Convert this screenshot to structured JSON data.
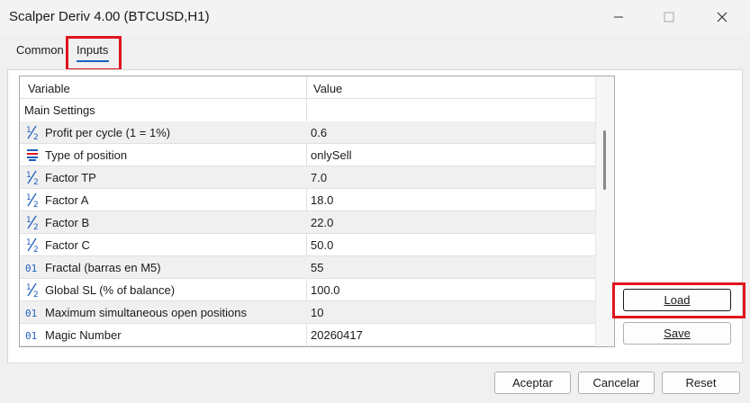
{
  "window": {
    "title": "Scalper Deriv 4.00 (BTCUSD,H1)"
  },
  "tabs": [
    {
      "label": "Common"
    },
    {
      "label": "Inputs"
    }
  ],
  "grid": {
    "headers": {
      "variable": "Variable",
      "value": "Value"
    },
    "section": "Main Settings",
    "rows": [
      {
        "icon": "fraction-icon",
        "name": "Profit per cycle (1 = 1%)",
        "value": "0.6"
      },
      {
        "icon": "enum-list-icon",
        "name": "Type of position",
        "value": "onlySell"
      },
      {
        "icon": "fraction-icon",
        "name": "Factor TP",
        "value": "7.0"
      },
      {
        "icon": "fraction-icon",
        "name": "Factor A",
        "value": "18.0"
      },
      {
        "icon": "fraction-icon",
        "name": "Factor B",
        "value": "22.0"
      },
      {
        "icon": "fraction-icon",
        "name": "Factor C",
        "value": "50.0"
      },
      {
        "icon": "integer-icon",
        "name": "Fractal (barras en M5)",
        "value": "55"
      },
      {
        "icon": "fraction-icon",
        "name": "Global SL (% of balance)",
        "value": "100.0"
      },
      {
        "icon": "integer-icon",
        "name": "Maximum simultaneous open positions",
        "value": "10"
      },
      {
        "icon": "integer-icon",
        "name": "Magic Number",
        "value": "20260417"
      }
    ]
  },
  "buttons": {
    "load": "Load",
    "save": "Save",
    "accept": "Aceptar",
    "cancel": "Cancelar",
    "reset": "Reset"
  },
  "colors": {
    "accent": "#1664c0",
    "highlight": "#e0141e",
    "icon_blue": "#1f5fbf"
  }
}
